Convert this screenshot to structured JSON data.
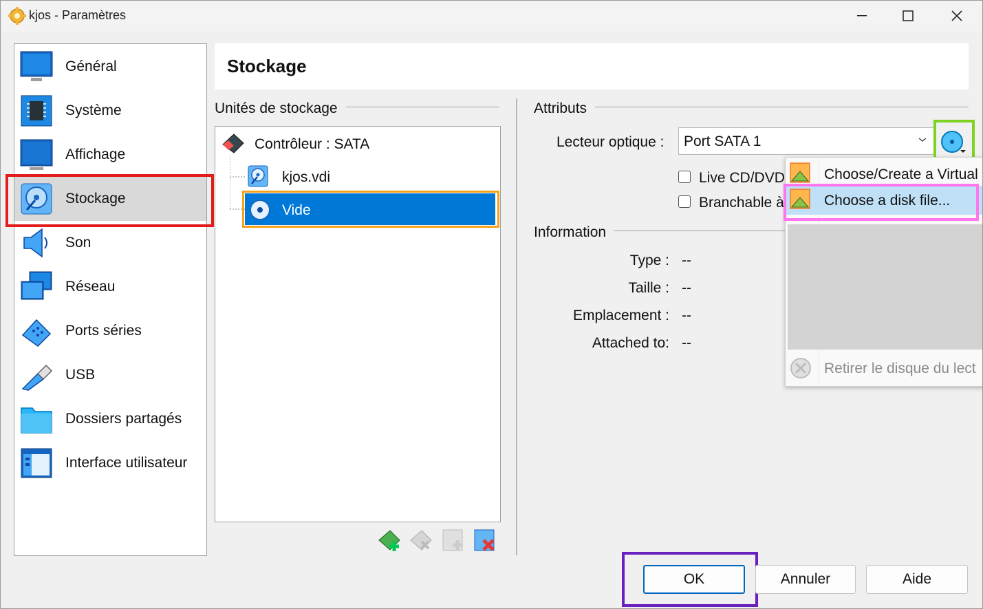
{
  "window": {
    "title": "kjos - Paramètres"
  },
  "sidebar": {
    "items": [
      {
        "label": "Général",
        "icon": "general-monitor-icon"
      },
      {
        "label": "Système",
        "icon": "system-chip-icon"
      },
      {
        "label": "Affichage",
        "icon": "display-monitor-icon"
      },
      {
        "label": "Stockage",
        "icon": "storage-disk-icon",
        "selected": true
      },
      {
        "label": "Son",
        "icon": "speaker-icon"
      },
      {
        "label": "Réseau",
        "icon": "network-icon"
      },
      {
        "label": "Ports séries",
        "icon": "serial-port-icon"
      },
      {
        "label": "USB",
        "icon": "usb-icon"
      },
      {
        "label": "Dossiers partagés",
        "icon": "shared-folder-icon"
      },
      {
        "label": "Interface utilisateur",
        "icon": "user-interface-icon"
      }
    ]
  },
  "header": {
    "title": "Stockage"
  },
  "storage": {
    "group_label": "Unités de stockage",
    "controller": "Contrôleur : SATA",
    "disk": "kjos.vdi",
    "optical": "Vide"
  },
  "attributes": {
    "group_label": "Attributs",
    "optical_drive_label": "Lecteur optique :",
    "optical_drive_value": "Port SATA 1",
    "live_cd_label": "Live CD/DVD",
    "hotplug_label": "Branchable à"
  },
  "information": {
    "group_label": "Information",
    "rows": [
      {
        "label": "Type :",
        "value": "--"
      },
      {
        "label": "Taille :",
        "value": "--"
      },
      {
        "label": "Emplacement :",
        "value": "--"
      },
      {
        "label": "Attached to:",
        "value": "--"
      }
    ]
  },
  "menu": {
    "items": [
      {
        "label": "Choose/Create a Virtual"
      },
      {
        "label": "Choose a disk file..."
      },
      {
        "label": "Retirer le disque du lect"
      }
    ]
  },
  "buttons": {
    "ok": "OK",
    "cancel": "Annuler",
    "help": "Aide"
  },
  "colors": {
    "selection": "#0078d7",
    "accent_orange": "#f5a21a",
    "annotation_red": "#e31b1b",
    "annotation_green": "#7ed321",
    "annotation_pink": "#ff77ee",
    "annotation_purple": "#6a1fbf"
  }
}
